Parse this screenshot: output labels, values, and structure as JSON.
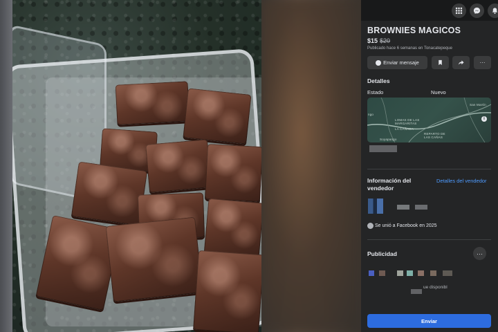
{
  "listing": {
    "title": "BROWNIES MAGICOS",
    "price": "$15",
    "old_price": "$20",
    "posted": "Publicado hace 6 semanas en Tonacatepeque"
  },
  "actions": {
    "message_label": "Enviar mensaje"
  },
  "details": {
    "heading": "Detalles",
    "condition_label": "Estado",
    "condition_value": "Nuevo"
  },
  "map": {
    "labels": [
      "San Martín",
      "LOMAS DE LAS MARGARITAS",
      "LA CAÑADA",
      "Soyapango",
      "REPARTO DE LAS CAÑAS"
    ],
    "left_fragment": "ngo"
  },
  "seller": {
    "heading": "Información del vendedor",
    "details_link": "Detalles del vendedor",
    "joined": "Se unió a Facebook en 2025"
  },
  "ads": {
    "heading": "Publicidad",
    "more_symbol": "···"
  },
  "message_box": {
    "fragment": "ue disponibl",
    "send_label": "Enviar"
  },
  "colors": {
    "background": "#18191a",
    "panel": "#242526",
    "button": "#3a3b3c",
    "link": "#4e9bff",
    "primary": "#2d6cdf"
  },
  "icons": [
    "apps-grid-icon",
    "messenger-icon",
    "notifications-icon",
    "messenger-bolt-icon",
    "bookmark-icon",
    "share-icon",
    "more-icon",
    "info-icon",
    "globe-icon"
  ]
}
